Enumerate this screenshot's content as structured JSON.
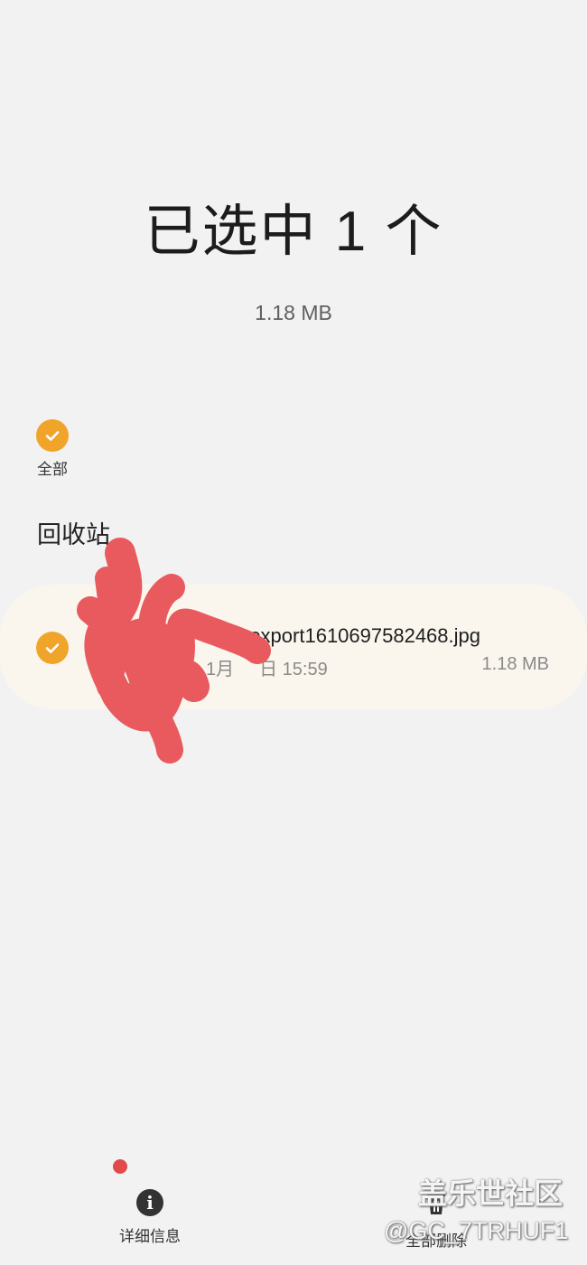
{
  "header": {
    "title": "已选中 1 个",
    "total_size": "1.18 MB"
  },
  "select_all": {
    "label": "全部",
    "checked": true
  },
  "section": {
    "title": "回收站"
  },
  "file": {
    "name": "mexport1610697582468.jpg",
    "date_prefix": "1月",
    "date_suffix": "日 15:59",
    "size": "1.18 MB",
    "checked": true
  },
  "bottom_bar": {
    "details_label": "详细信息",
    "delete_all_label": "全部删除"
  },
  "watermark": {
    "line1": "盖乐世社区",
    "line2": "@GC_7TRHUF1"
  },
  "colors": {
    "accent": "#f0a52a",
    "background": "#f2f2f2",
    "card": "#faf6ee",
    "scribble": "#e85a5e"
  }
}
